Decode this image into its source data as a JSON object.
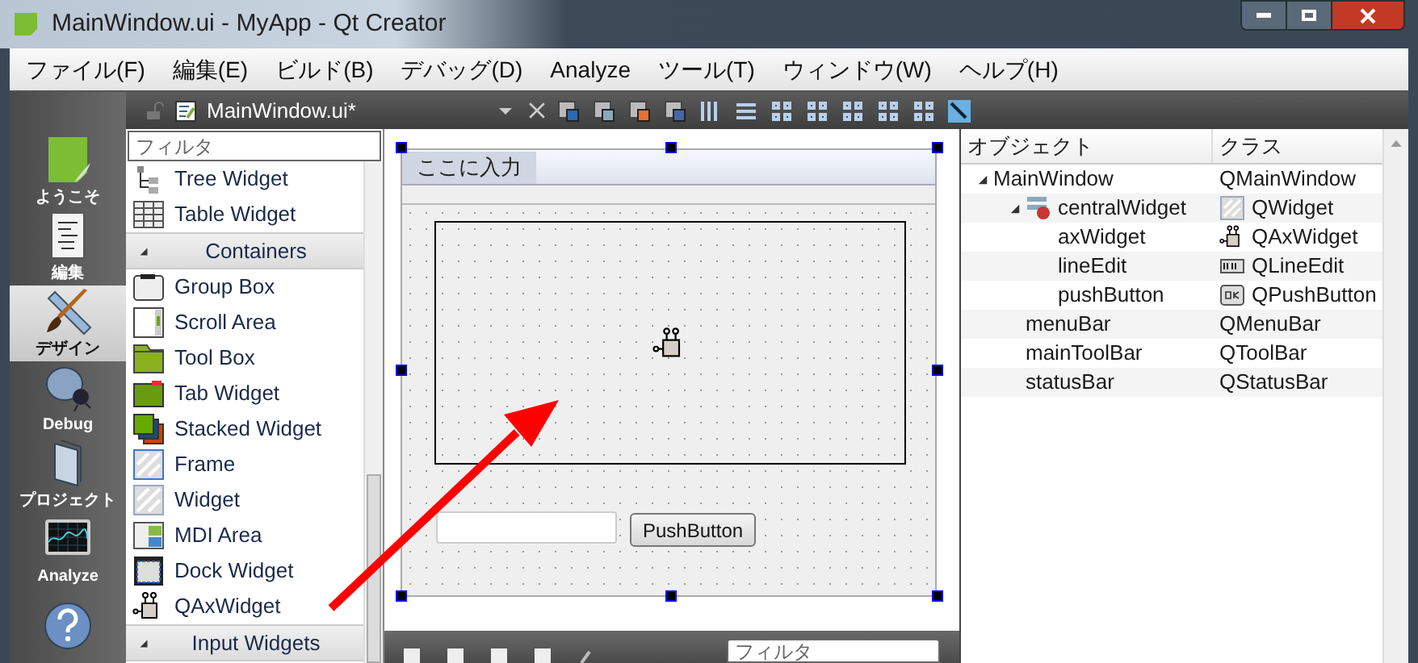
{
  "window": {
    "title": "MainWindow.ui - MyApp - Qt Creator"
  },
  "menu_bar": [
    "ファイル(F)",
    "編集(E)",
    "ビルド(B)",
    "デバッグ(D)",
    "Analyze",
    "ツール(T)",
    "ウィンドウ(W)",
    "ヘルプ(H)"
  ],
  "editor_toolbar": {
    "file": "MainWindow.ui*"
  },
  "modes": [
    {
      "label": "ようこそ",
      "kind": "welcome",
      "selected": false
    },
    {
      "label": "編集",
      "kind": "edit",
      "selected": false
    },
    {
      "label": "デザイン",
      "kind": "design",
      "selected": true
    },
    {
      "label": "Debug",
      "kind": "debug",
      "selected": false
    },
    {
      "label": "プロジェクト",
      "kind": "projects",
      "selected": false
    },
    {
      "label": "Analyze",
      "kind": "analyze",
      "selected": false
    },
    {
      "kind": "help",
      "selected": false
    }
  ],
  "widget_box": {
    "filter_placeholder": "フィルタ",
    "items": [
      {
        "kind": "widget",
        "label": "Tree Widget"
      },
      {
        "kind": "widget",
        "label": "Table Widget"
      },
      {
        "kind": "category",
        "label": "Containers"
      },
      {
        "kind": "widget",
        "label": "Group Box"
      },
      {
        "kind": "widget",
        "label": "Scroll Area"
      },
      {
        "kind": "widget",
        "label": "Tool Box"
      },
      {
        "kind": "widget",
        "label": "Tab Widget"
      },
      {
        "kind": "widget",
        "label": "Stacked Widget"
      },
      {
        "kind": "widget",
        "label": "Frame"
      },
      {
        "kind": "widget",
        "label": "Widget"
      },
      {
        "kind": "widget",
        "label": "MDI Area"
      },
      {
        "kind": "widget",
        "label": "Dock Widget"
      },
      {
        "kind": "widget",
        "label": "QAxWidget"
      },
      {
        "kind": "category",
        "label": "Input Widgets"
      }
    ]
  },
  "form": {
    "menu_item": "ここに入力",
    "button": "PushButton"
  },
  "bottom_bar": {
    "filter_placeholder": "フィルタ"
  },
  "object_inspector": {
    "columns": [
      "オブジェクト",
      "クラス"
    ],
    "tree": [
      {
        "name": "MainWindow",
        "class": "QMainWindow",
        "expanded": true,
        "children": [
          {
            "name": "centralWidget",
            "class": "QWidget",
            "kind": "widget",
            "expanded": true,
            "children": [
              {
                "name": "axWidget",
                "class": "QAxWidget",
                "kind": "activex"
              },
              {
                "name": "lineEdit",
                "class": "QLineEdit",
                "kind": "lineedit"
              },
              {
                "name": "pushButton",
                "class": "QPushButton",
                "kind": "button"
              }
            ]
          },
          {
            "name": "menuBar",
            "class": "QMenuBar"
          },
          {
            "name": "mainToolBar",
            "class": "QToolBar"
          },
          {
            "name": "statusBar",
            "class": "QStatusBar"
          }
        ]
      }
    ]
  }
}
